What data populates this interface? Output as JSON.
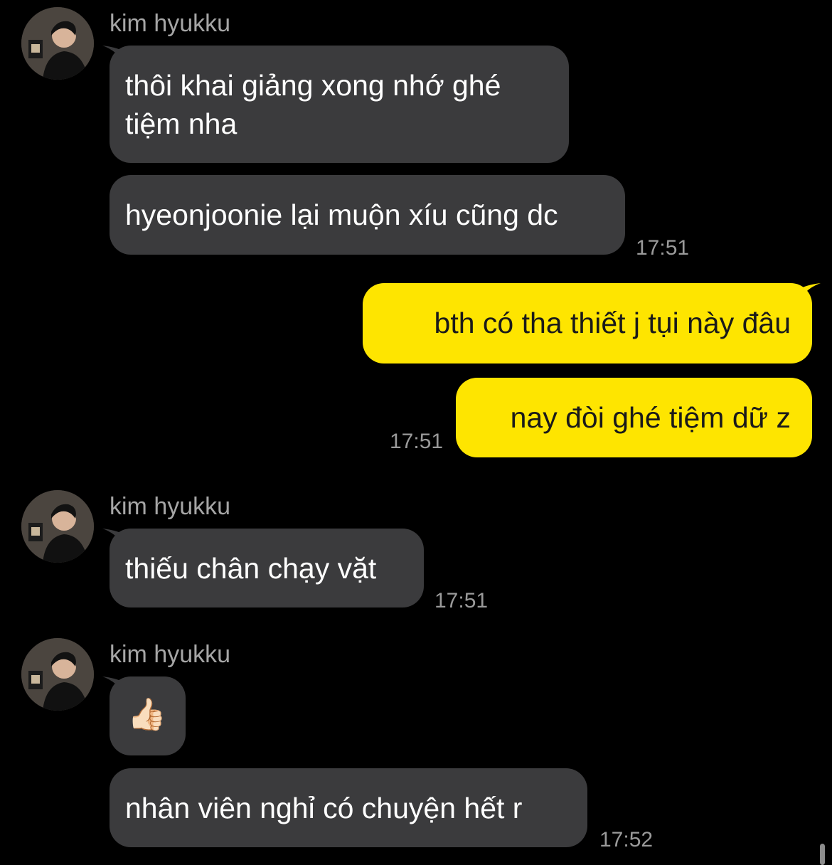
{
  "colors": {
    "background": "#000000",
    "incoming_bubble": "#3b3b3d",
    "outgoing_bubble": "#fee500",
    "timestamp": "#9a9a9a",
    "sender_name": "#a6a6a6"
  },
  "groups": [
    {
      "sender": "kim hyukku",
      "avatar": "profile-photo",
      "messages": [
        {
          "line1": "thôi khai giảng xong nhớ ghé",
          "line2": "tiệm nha"
        },
        {
          "text": "hyeonjoonie lại muộn xíu cũng dc"
        }
      ],
      "time": "17:51"
    },
    {
      "sender": "me",
      "messages": [
        {
          "text": "bth có tha thiết j tụi này đâu"
        },
        {
          "text": "nay đòi ghé tiệm dữ z"
        }
      ],
      "time": "17:51"
    },
    {
      "sender": "kim hyukku",
      "avatar": "profile-photo",
      "messages": [
        {
          "text": "thiếu chân chạy vặt"
        }
      ],
      "time": "17:51"
    },
    {
      "sender": "kim hyukku",
      "avatar": "profile-photo",
      "messages": [
        {
          "text": "👍🏻",
          "icon": "thumbs-up-emoji"
        },
        {
          "text": "nhân viên nghỉ có chuyện hết r"
        }
      ],
      "time": "17:52"
    }
  ]
}
